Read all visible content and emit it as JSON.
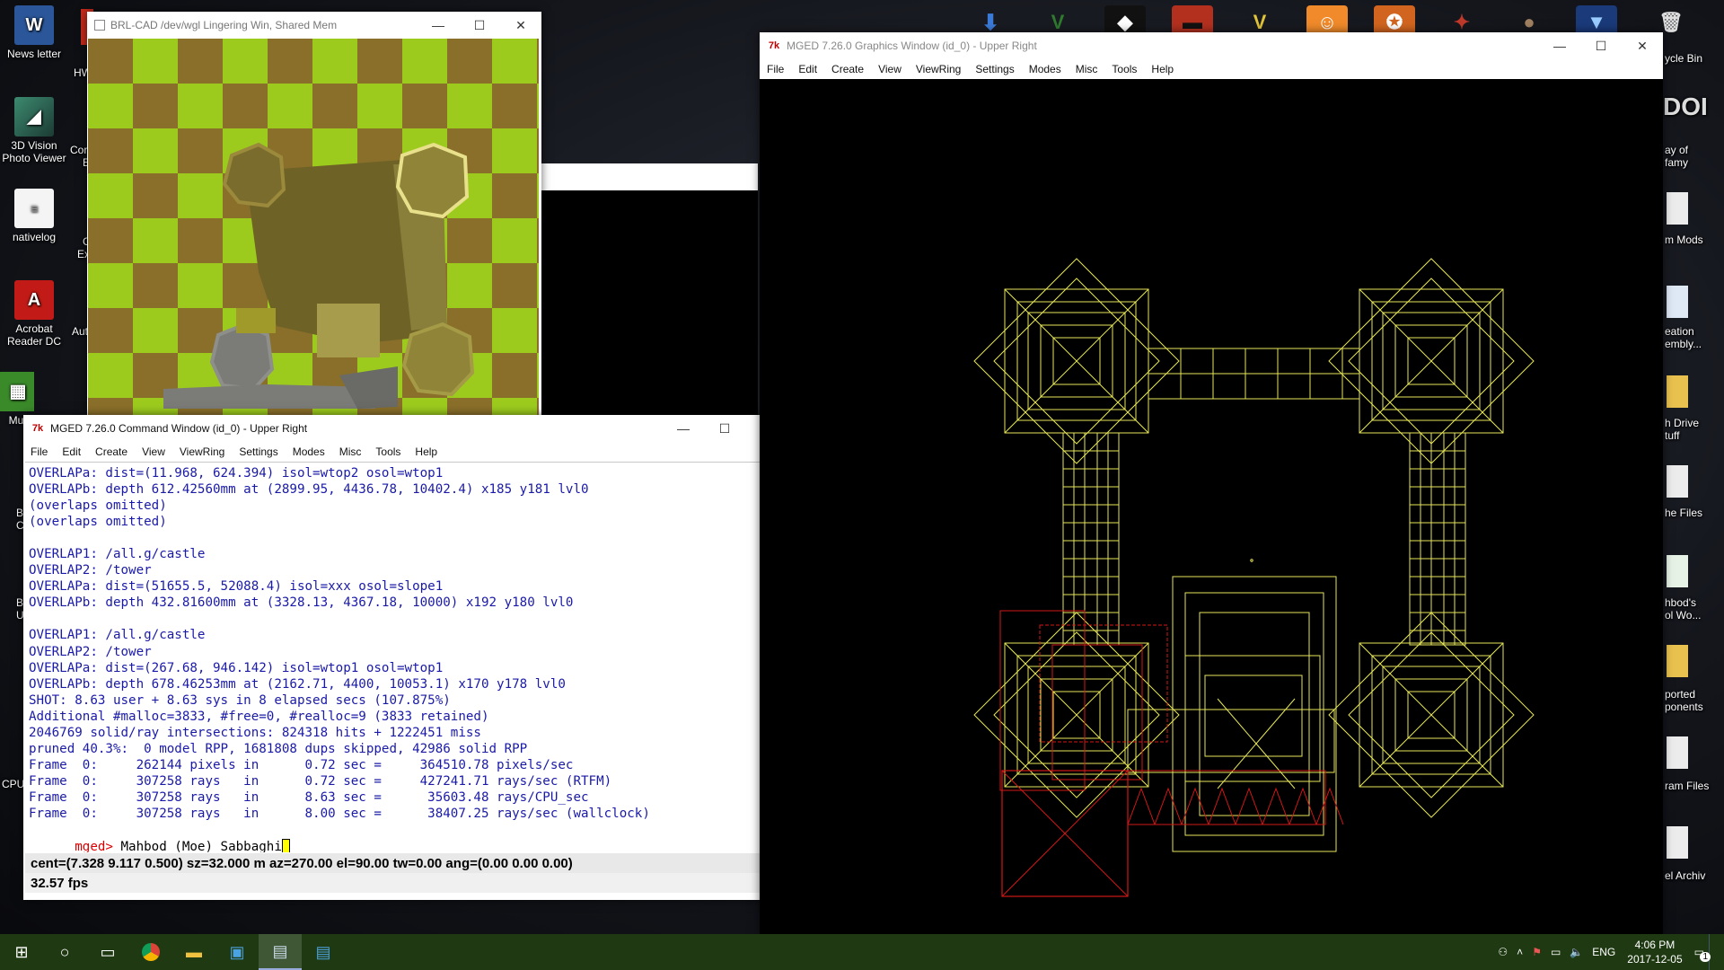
{
  "desktop": {
    "left_icons": [
      {
        "label": "News letter",
        "icon": "word-doc-icon",
        "color": "#2b579a"
      },
      {
        "label": "3D Vision Photo Viewer",
        "icon": "3d-vision-icon",
        "color": "#2e6b5a"
      },
      {
        "label": "nativelog",
        "icon": "text-file-icon",
        "color": "#f2f2f2"
      },
      {
        "label": "Acrobat Reader DC",
        "icon": "acrobat-icon",
        "color": "#c21b17"
      },
      {
        "label": "Mu",
        "icon": "app-tile-icon",
        "color": "#3a8a2a"
      }
    ],
    "partial_labels": [
      "HW",
      "Cor",
      "E",
      "G",
      "Ex",
      "Aut",
      "B",
      "C",
      "B",
      "U",
      "CPU"
    ],
    "right_labels": [
      "ycle Bin",
      "ay of",
      "famy",
      "m Mods",
      "eation",
      "embly...",
      "h Drive",
      "tuff",
      "he Files",
      "hbod's",
      "ol Wo...",
      "ported",
      "ponents",
      "ram Files",
      "el Archiv"
    ],
    "right_banner": "DOI"
  },
  "raytrace_window": {
    "title": "BRL-CAD /dev/wgl Lingering Win, Shared Mem",
    "controls": {
      "minimize": "—",
      "maximize": "☐",
      "close": "✕"
    }
  },
  "command_window": {
    "title": "MGED 7.26.0 Command Window (id_0) - Upper Right",
    "menu": [
      "File",
      "Edit",
      "Create",
      "View",
      "ViewRing",
      "Settings",
      "Modes",
      "Misc",
      "Tools",
      "Help"
    ],
    "lines": [
      "OVERLAPa: dist=(11.968, 624.394) isol=wtop2 osol=wtop1",
      "OVERLAPb: depth 612.42560mm at (2899.95, 4436.78, 10402.4) x185 y181 lvl0",
      "(overlaps omitted)",
      "(overlaps omitted)",
      "",
      "OVERLAP1: /all.g/castle",
      "OVERLAP2: /tower",
      "OVERLAPa: dist=(51655.5, 52088.4) isol=xxx osol=slope1",
      "OVERLAPb: depth 432.81600mm at (3328.13, 4367.18, 10000) x192 y180 lvl0",
      "",
      "OVERLAP1: /all.g/castle",
      "OVERLAP2: /tower",
      "OVERLAPa: dist=(267.68, 946.142) isol=wtop1 osol=wtop1",
      "OVERLAPb: depth 678.46253mm at (2162.71, 4400, 10053.1) x170 y178 lvl0",
      "SHOT: 8.63 user + 8.63 sys in 8 elapsed secs (107.875%)",
      "Additional #malloc=3833, #free=0, #realloc=9 (3833 retained)",
      "2046769 solid/ray intersections: 824318 hits + 1222451 miss",
      "pruned 40.3%:  0 model RPP, 1681808 dups skipped, 42986 solid RPP",
      "Frame  0:     262144 pixels in      0.72 sec =     364510.78 pixels/sec",
      "Frame  0:     307258 rays   in      0.72 sec =     427241.71 rays/sec (RTFM)",
      "Frame  0:     307258 rays   in      8.63 sec =      35603.48 rays/CPU_sec",
      "Frame  0:     307258 rays   in      8.00 sec =      38407.25 rays/sec (wallclock)"
    ],
    "prompt": "mged>",
    "input": " Mahbod (Moe) Sabbaghi",
    "status_view": "cent=(7.328 9.117 0.500) sz=32.000  m  az=270.00  el=90.00  tw=0.00  ang=(0.00 0.00 0.00)",
    "status_fps": "32.57 fps"
  },
  "graphics_window": {
    "title": "MGED 7.26.0 Graphics Window (id_0) - Upper Right",
    "menu": [
      "File",
      "Edit",
      "Create",
      "View",
      "ViewRing",
      "Settings",
      "Modes",
      "Misc",
      "Tools",
      "Help"
    ],
    "wire_color": "#e6e65a",
    "highlight_color": "#d01818"
  },
  "taskbar": {
    "apps": [
      "start-icon",
      "cortana-icon",
      "task-view-icon",
      "chrome-icon",
      "file-explorer-icon",
      "store-icon",
      "mged-icon",
      "mged-graphics-icon"
    ],
    "tray_lang": "ENG",
    "time": "4:06 PM",
    "date": "2017-12-05",
    "notification_count": "1"
  },
  "colors": {
    "taskbar": "#1f3a12",
    "tcl_icon": "#c00000",
    "console_text": "#1a1aa8",
    "prompt": "#dd0000"
  }
}
